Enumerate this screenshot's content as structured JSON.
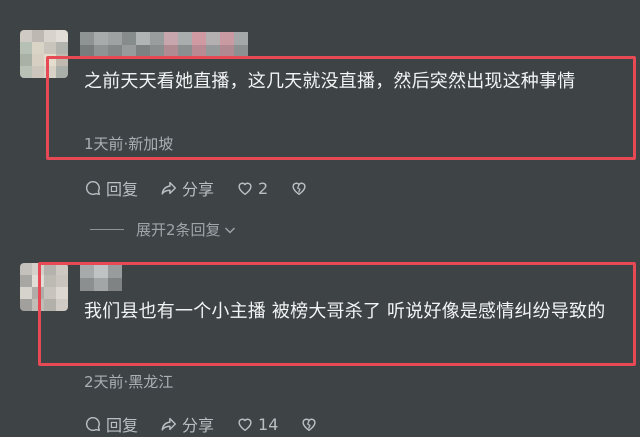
{
  "comments": [
    {
      "text": "之前天天看她直播，这几天就没直播，然后突然出现这种事情",
      "meta": "1天前·新加坡",
      "reply_label": "回复",
      "share_label": "分享",
      "like_count": "2"
    },
    {
      "text": "我们县也有一个小主播 被榜大哥杀了 听说好像是感情纠纷导致的",
      "meta": "2天前·黑龙江",
      "reply_label": "回复",
      "share_label": "分享",
      "like_count": "14"
    }
  ],
  "expand_replies_label": "展开2条回复",
  "colors": {
    "background": "#3e4346",
    "highlight_border": "#e84a55",
    "meta_text": "#a9b0b4"
  },
  "icons": [
    "reply-icon",
    "share-icon",
    "heart-icon",
    "dislike-heart-icon",
    "chevron-down-icon"
  ]
}
